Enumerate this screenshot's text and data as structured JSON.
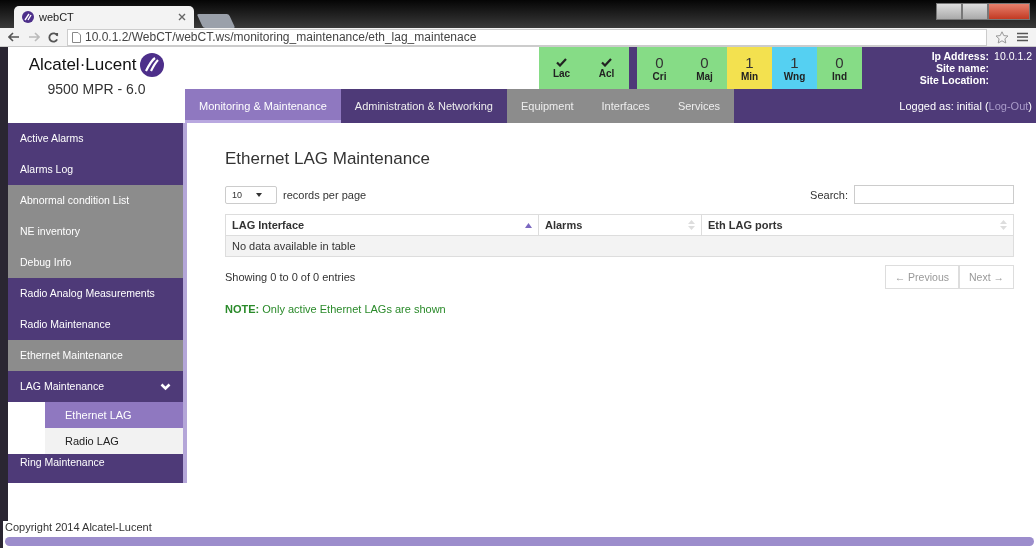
{
  "browser": {
    "tab_title": "webCT",
    "url": "10.0.1.2/WebCT/webCT.ws/monitoring_maintenance/eth_lag_maintenace"
  },
  "header": {
    "logo": "Alcatel·Lucent",
    "product": "9500 MPR - 6.0",
    "alarms": [
      {
        "kind": "check",
        "label": "Lac",
        "color": "#86dc86"
      },
      {
        "kind": "check",
        "label": "Acl",
        "color": "#86dc86"
      },
      {
        "kind": "count",
        "value": "0",
        "label": "Cri",
        "color": "#86dc86"
      },
      {
        "kind": "count",
        "value": "0",
        "label": "Maj",
        "color": "#86dc86"
      },
      {
        "kind": "count",
        "value": "1",
        "label": "Min",
        "color": "#f3e14f"
      },
      {
        "kind": "count",
        "value": "1",
        "label": "Wng",
        "color": "#55d0f2"
      },
      {
        "kind": "count",
        "value": "0",
        "label": "Ind",
        "color": "#86dc86"
      }
    ],
    "site_info": [
      {
        "label": "Ip Address:",
        "value": "10.0.1.2"
      },
      {
        "label": "Site name:"
      },
      {
        "label": "Site Location:"
      }
    ],
    "nav_tabs": [
      {
        "label": "Monitoring & Maintenance",
        "selected": true,
        "color": "#8f78c0"
      },
      {
        "label": "Administration & Networking",
        "selected": false,
        "color": "#4e3a78"
      },
      {
        "label": "Equipment",
        "selected": false,
        "color": "#8c8c8c"
      },
      {
        "label": "Interfaces",
        "selected": false,
        "color": "#8c8c8c"
      },
      {
        "label": "Services",
        "selected": false,
        "color": "#8c8c8c"
      }
    ],
    "login": {
      "text": "Logged as: initial (",
      "link": "Log-Out",
      "close": ")"
    }
  },
  "sidebar": {
    "items": [
      {
        "label": "Active Alarms",
        "color": "#4e3a78"
      },
      {
        "label": "Alarms Log",
        "color": "#4e3a78"
      },
      {
        "label": "Abnormal condition List",
        "color": "#8c8c8c"
      },
      {
        "label": "NE inventory",
        "color": "#8c8c8c"
      },
      {
        "label": "Debug Info",
        "color": "#8c8c8c"
      },
      {
        "label": "Radio Analog Measurements",
        "color": "#4e3a78"
      },
      {
        "label": "Radio Maintenance",
        "color": "#4e3a78"
      },
      {
        "label": "Ethernet Maintenance",
        "color": "#8c8c8c"
      },
      {
        "label": "LAG Maintenance",
        "color": "#4e3a78",
        "expanded": true,
        "children": [
          {
            "label": "Ethernet LAG",
            "selected": true
          },
          {
            "label": "Radio LAG",
            "selected": false
          }
        ]
      },
      {
        "label": "Ring Maintenance",
        "color": "#4e3a78"
      }
    ]
  },
  "main": {
    "title": "Ethernet LAG Maintenance",
    "page_size": "10",
    "page_size_label": "records per page",
    "search_label": "Search:",
    "table": {
      "columns": [
        {
          "label": "LAG Interface",
          "sorted": true
        },
        {
          "label": "Alarms",
          "sorted": false
        },
        {
          "label": "Eth LAG ports",
          "sorted": false
        }
      ],
      "empty_message": "No data available in table"
    },
    "info": "Showing 0 to 0 of 0 entries",
    "pagination": [
      {
        "label": "← Previous",
        "disabled": true
      },
      {
        "label": "Next →",
        "disabled": true
      }
    ],
    "note": "**NOTE:** Only active Ethernet LAGs are shown"
  },
  "footer": {
    "copyright": "Copyright 2014 Alcatel-Lucent"
  }
}
